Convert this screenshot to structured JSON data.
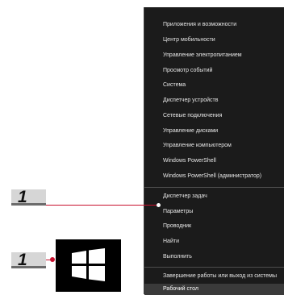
{
  "callouts": [
    {
      "label": "1"
    },
    {
      "label": "1"
    }
  ],
  "start_button": {
    "icon": "windows-logo-icon"
  },
  "context_menu": {
    "items": [
      {
        "label": "Приложения и возможности"
      },
      {
        "label": "Центр мобильности"
      },
      {
        "label": "Управление электропитанием"
      },
      {
        "label": "Просмотр событий"
      },
      {
        "label": "Система"
      },
      {
        "label": "Диспетчер устройств"
      },
      {
        "label": "Сетевые подключения"
      },
      {
        "label": "Управление дисками"
      },
      {
        "label": "Управление компьютером"
      },
      {
        "label": "Windows PowerShell"
      },
      {
        "label": "Windows PowerShell (администратор)"
      },
      {
        "label": "Диспетчер задач"
      },
      {
        "label": "Параметры"
      },
      {
        "label": "Проводник"
      },
      {
        "label": "Найти"
      },
      {
        "label": "Выполнить"
      },
      {
        "label": "Завершение работы или выход из системы"
      },
      {
        "label": "Рабочий стол"
      }
    ]
  },
  "colors": {
    "menu_background": "#1b1b1b",
    "menu_text": "#e6e6e6",
    "highlight": "#3a3a3a",
    "leader_line": "#c8102e",
    "callout_fill": "#d6d6d6"
  }
}
